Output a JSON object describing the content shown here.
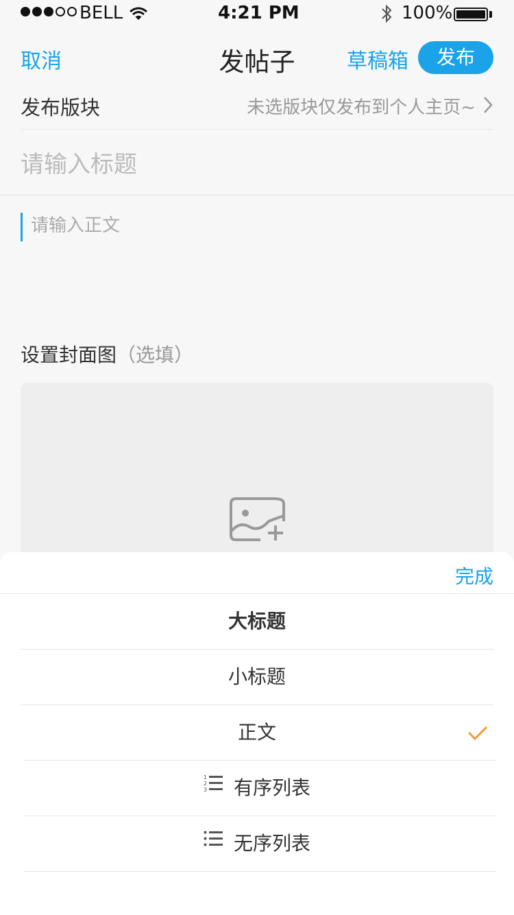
{
  "status_bar": {
    "carrier": "BELL",
    "time": "4:21 PM",
    "battery": "100%",
    "battery_level": 1.0
  },
  "nav": {
    "cancel": "取消",
    "title": "发帖子",
    "drafts": "草稿箱",
    "publish": "发布"
  },
  "section": {
    "label": "发布版块",
    "value": "未选版块仅发布到个人主页~"
  },
  "post": {
    "title_placeholder": "请输入标题",
    "body_placeholder": "请输入正文"
  },
  "cover": {
    "label": "设置封面图",
    "optional": "（选填）"
  },
  "format_sheet": {
    "done": "完成",
    "options": [
      {
        "label": "大标题"
      },
      {
        "label": "小标题"
      },
      {
        "label": "正文",
        "selected": true
      },
      {
        "label": "有序列表",
        "icon": "ordered-list-icon"
      },
      {
        "label": "无序列表",
        "icon": "unordered-list-icon"
      }
    ]
  },
  "colors": {
    "accent": "#1aa3e8",
    "check": "#f39a2e",
    "background": "#f7f7f7"
  }
}
